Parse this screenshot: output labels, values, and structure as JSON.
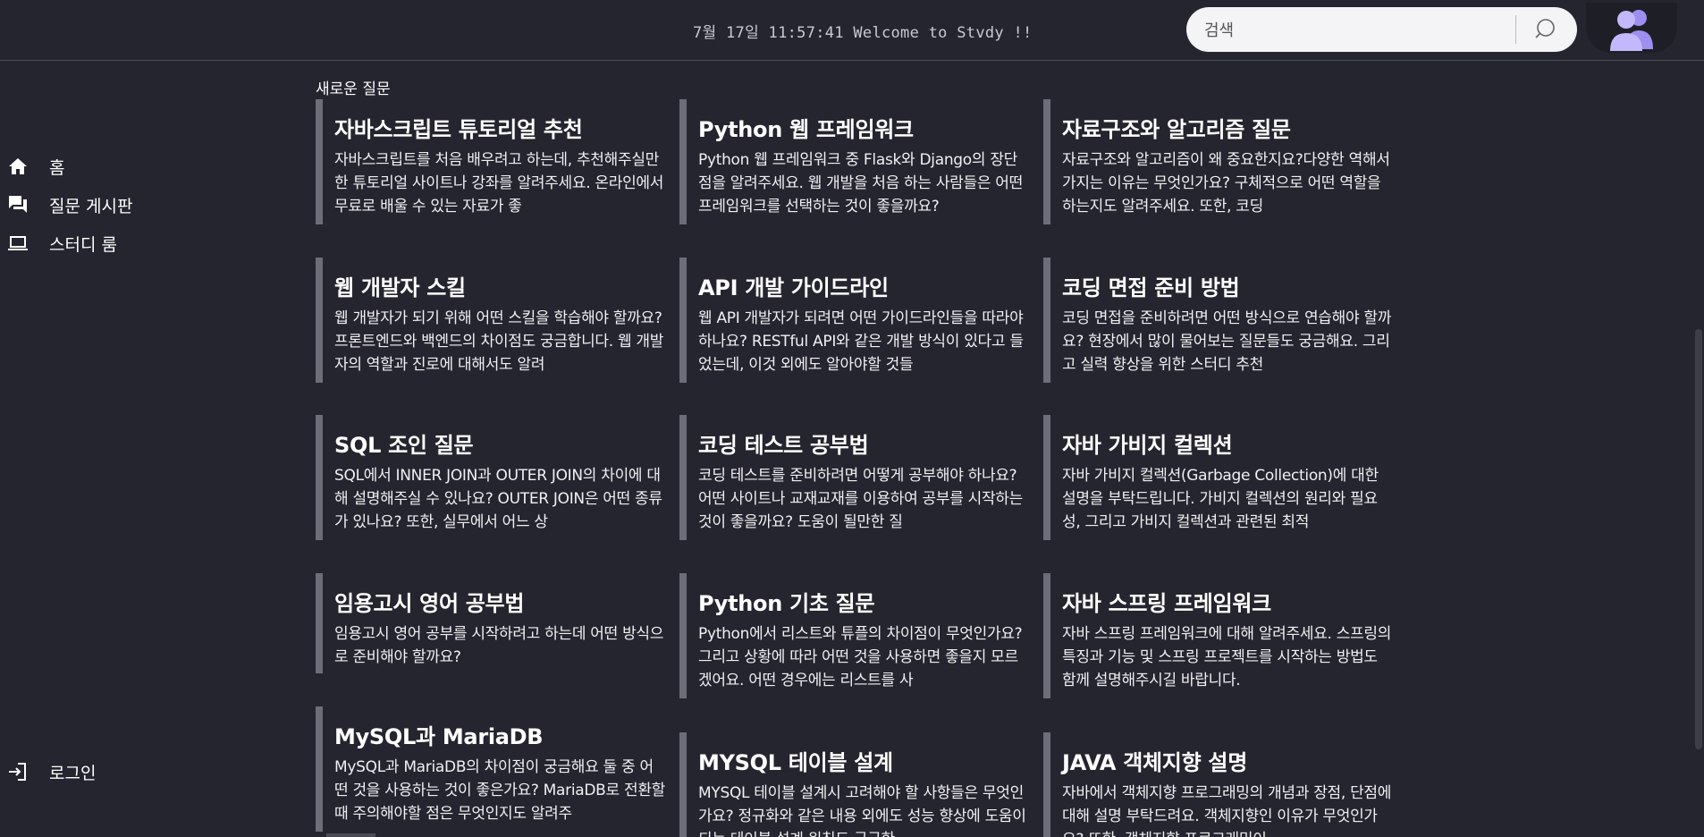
{
  "header": {
    "welcome": "7월 17일 11:57:41 Welcome to Stvdy !!",
    "search_placeholder": "검색"
  },
  "sidebar": {
    "items": [
      {
        "label": "홈",
        "icon": "home-icon"
      },
      {
        "label": "질문 게시판",
        "icon": "forum-icon"
      },
      {
        "label": "스터디 룸",
        "icon": "laptop-icon"
      }
    ],
    "login": {
      "label": "로그인",
      "icon": "login-icon"
    }
  },
  "main": {
    "section_title": "새로운 질문",
    "cards": [
      {
        "title": "자바스크립트 튜토리얼 추천",
        "body": "자바스크립트를 처음 배우려고 하는데, 추천해주실만한 튜토리얼 사이트나 강좌를 알려주세요. 온라인에서 무료로 배울 수 있는 자료가 좋"
      },
      {
        "title": "Python 웹 프레임워크",
        "body": "Python 웹 프레임워크 중 Flask와 Django의 장단점을 알려주세요. 웹 개발을 처음 하는 사람들은 어떤 프레임워크를 선택하는 것이 좋을까요?"
      },
      {
        "title": "자료구조와 알고리즘 질문",
        "body": "자료구조와 알고리즘이 왜 중요한지요?다양한 역해서 가지는 이유는 무엇인가요? 구체적으로 어떤 역할을 하는지도 알려주세요. 또한, 코딩"
      },
      {
        "title": "웹 개발자 스킬",
        "body": "웹 개발자가 되기 위해 어떤 스킬을 학습해야 할까요? 프론트엔드와 백엔드의 차이점도 궁금합니다. 웹 개발자의 역할과 진로에 대해서도 알려"
      },
      {
        "title": "API 개발 가이드라인",
        "body": "웹 API 개발자가 되려면 어떤 가이드라인들을 따라야 하나요? RESTful API와 같은 개발 방식이 있다고 들었는데, 이것 외에도 알아야할 것들"
      },
      {
        "title": "코딩 면접 준비 방법",
        "body": "코딩 면접을 준비하려면 어떤 방식으로 연습해야 할까요? 현장에서 많이 물어보는 질문들도 궁금해요. 그리고 실력 향상을 위한 스터디 추천"
      },
      {
        "title": "SQL 조인 질문",
        "body": "SQL에서 INNER JOIN과 OUTER JOIN의 차이에 대해 설명해주실 수 있나요? OUTER JOIN은 어떤 종류가 있나요? 또한, 실무에서 어느 상"
      },
      {
        "title": "코딩 테스트 공부법",
        "body": "코딩 테스트를 준비하려면 어떻게 공부해야 하나요? 어떤 사이트나 교재교재를 이용하여 공부를 시작하는 것이 좋을까요? 도움이 될만한 질"
      },
      {
        "title": "자바 가비지 컬렉션",
        "body": "자바 가비지 컬렉션(Garbage Collection)에 대한 설명을 부탁드립니다. 가비지 컬렉션의 원리와 필요성, 그리고 가비지 컬렉션과 관련된 최적"
      },
      {
        "title": "임용고시 영어 공부법",
        "body": "임용고시 영어 공부를 시작하려고 하는데 어떤 방식으로 준비해야 할까요?"
      },
      {
        "title": "Python 기초 질문",
        "body": "Python에서 리스트와 튜플의 차이점이 무엇인가요? 그리고 상황에 따라 어떤 것을 사용하면 좋을지 모르겠어요. 어떤 경우에는 리스트를 사"
      },
      {
        "title": "자바 스프링 프레임워크",
        "body": "자바 스프링 프레임워크에 대해 알려주세요. 스프링의 특징과 기능 및 스프링 프로젝트를 시작하는 방법도 함께 설명해주시길 바랍니다."
      },
      {
        "title": "MySQL과 MariaDB",
        "body": "MySQL과 MariaDB의 차이점이 궁금해요 둘 중 어떤 것을 사용하는 것이 좋은가요? MariaDB로 전환할 때 주의해야할 점은 무엇인지도 알려주"
      },
      {
        "title": "MYSQL 테이블 설계",
        "body": "MYSQL 테이블 설계시 고려해야 할 사항들은 무엇인가요? 정규화와 같은 내용 외에도 성능 향상에 도움이 되는 테이블 설계 원칙도 궁금한"
      },
      {
        "title": "JAVA 객체지향 설명",
        "body": "자바에서 객체지향 프로그래밍의 개념과 장점, 단점에 대해 설명 부탁드려요. 객체지향인 이유가 무엇인가요? 또한, 객체지향 프로그래밍이"
      }
    ]
  },
  "colors": {
    "background": "#24252e",
    "card_bar": "#6c6d78",
    "search_bg": "#f4f4f7",
    "avatar": "#b5a8f5"
  }
}
